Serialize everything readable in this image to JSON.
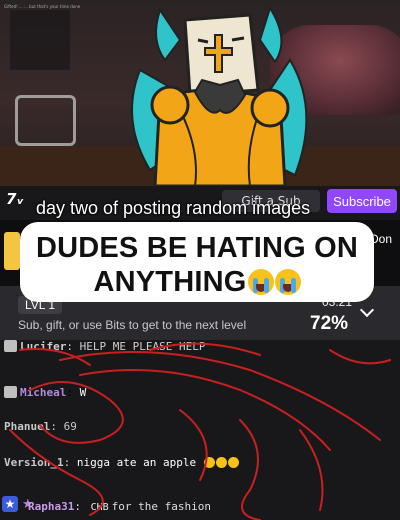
{
  "stream": {
    "overlay_text": "Gifted! ... ... but that's your time done"
  },
  "channel_bar": {
    "logo": "7ᵥ",
    "gift_sub_label": "Gift a Sub",
    "subscribe_label": "Subscribe",
    "donate_label": "Don"
  },
  "caption": "day two of posting random images",
  "meme": {
    "line1": "DUDES BE HATING ON",
    "line2": "ANYTHING"
  },
  "hype_train": {
    "level": "LVL 1",
    "message": "Sub, gift, or use Bits to get to the next level",
    "timer": "03:21",
    "percent": "72%"
  },
  "chat": {
    "messages": [
      {
        "user": "Lucifer",
        "text": "HELP ME PLEASE HELP"
      },
      {
        "user": "Micheal",
        "text": "W"
      },
      {
        "user": "Phanuel",
        "text": "69"
      },
      {
        "user": "Version_1",
        "text": "nigga ate an apple"
      },
      {
        "user": "Rapha31",
        "emote": "CHB",
        "text": "for the fashion"
      }
    ]
  },
  "colors": {
    "accent": "#9147ff",
    "scribble": "#c8201e",
    "knight_gold": "#f2a516",
    "knight_teal": "#2ec4c9"
  }
}
